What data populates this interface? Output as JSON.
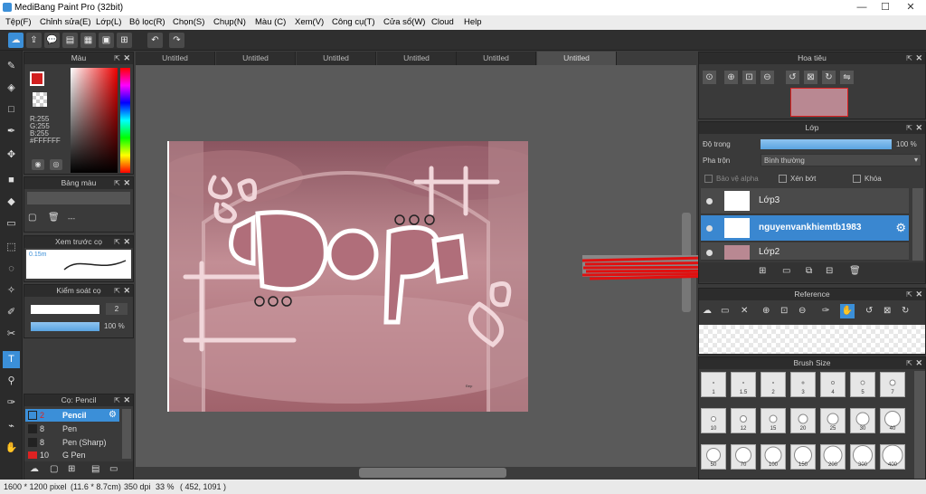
{
  "window": {
    "title": "MediBang Paint Pro (32bit)",
    "minimize": "—",
    "maximize": "☐",
    "close": "✕"
  },
  "menu": [
    "Tệp(F)",
    "Chỉnh sửa(E)",
    "Lớp(L)",
    "Bộ lọc(R)",
    "Chọn(S)",
    "Chụp(N)",
    "Màu (C)",
    "Xem(V)",
    "Công cụ(T)",
    "Cửa sổ(W)",
    "Cloud",
    "Help"
  ],
  "tabs": [
    "Untitled",
    "Untitled",
    "Untitled",
    "Untitled",
    "Untitled",
    "Untitled"
  ],
  "color_panel": {
    "title": "Màu",
    "r": "R:255",
    "g": "G:255",
    "b": "B:255",
    "hex": "#FFFFFF"
  },
  "palette_panel": {
    "title": "Bảng màu",
    "value": "---"
  },
  "brush_preview_panel": {
    "title": "Xem trước cọ",
    "size": "0.15m"
  },
  "brush_control_panel": {
    "title": "Kiểm soát cọ",
    "size_value": "2",
    "opacity_value": "100 %"
  },
  "brush_list_panel": {
    "title": "Cọ: Pencil",
    "items": [
      {
        "size": "2",
        "name": "Pencil",
        "color": "#3b8fd8"
      },
      {
        "size": "8",
        "name": "Pen",
        "color": "#222"
      },
      {
        "size": "8",
        "name": "Pen (Sharp)",
        "color": "#222"
      },
      {
        "size": "10",
        "name": "G Pen",
        "color": "#d22"
      }
    ]
  },
  "navigator_panel": {
    "title": "Hoa tiêu"
  },
  "layer_panel": {
    "title": "Lớp",
    "opacity_label": "Độ trong",
    "opacity_value": "100 %",
    "blend_label": "Pha trộn",
    "blend_value": "Bình thường",
    "protect_alpha": "Bảo vệ alpha",
    "clipping": "Xén bớt",
    "lock": "Khóa",
    "layers": [
      "Lớp3",
      "nguyenvankhiemtb1983",
      "Lớp2"
    ]
  },
  "reference_panel": {
    "title": "Reference"
  },
  "brush_size_panel": {
    "title": "Brush Size",
    "sizes": [
      "1",
      "1.5",
      "2",
      "3",
      "4",
      "5",
      "7",
      "10",
      "12",
      "15",
      "20",
      "25",
      "30",
      "40",
      "50",
      "70",
      "100",
      "150",
      "200",
      "300",
      "400"
    ]
  },
  "artwork": {
    "text": "Đẹp"
  },
  "status": {
    "size": "1600 * 1200 pixel",
    "cm": "(11.6 * 8.7cm)",
    "dpi": "350 dpi",
    "zoom": "33 %",
    "coords": "( 452, 1091 )"
  },
  "colors": {
    "accent": "#3b8fd8",
    "primary": "#d22020",
    "secondary": "#ffffff"
  }
}
